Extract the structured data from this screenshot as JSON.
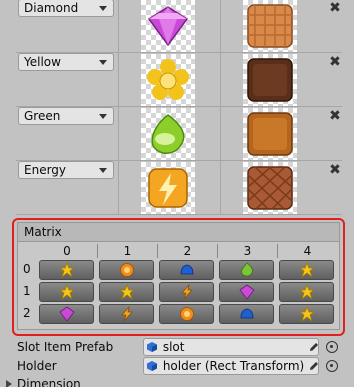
{
  "candy_rows": [
    {
      "label": "Diamond",
      "candy_icon": "diamond-candy-icon",
      "candy_color": "#c94ad6",
      "bg_icon": "waffle-tile-icon",
      "bg_color": "#d9894a"
    },
    {
      "label": "Yellow",
      "candy_icon": "yellow-flower-candy-icon",
      "candy_color": "#f2c31b",
      "bg_icon": "chocolate-tile-icon",
      "bg_color": "#5a2f1a"
    },
    {
      "label": "Green",
      "candy_icon": "green-drop-candy-icon",
      "candy_color": "#8ccf2a",
      "bg_icon": "caramel-tile-icon",
      "bg_color": "#b5651d"
    },
    {
      "label": "Energy",
      "candy_icon": "energy-bolt-candy-icon",
      "candy_color": "#f4a623",
      "bg_icon": "waffle-tile-icon",
      "bg_color": "#a85a34"
    }
  ],
  "matrix": {
    "title": "Matrix",
    "columns": [
      "0",
      "1",
      "2",
      "3",
      "4"
    ],
    "rows": [
      {
        "label": "0",
        "cells": [
          "yellow",
          "orange",
          "blue",
          "green",
          "yellow"
        ]
      },
      {
        "label": "1",
        "cells": [
          "yellow",
          "yellow",
          "energy",
          "diamond",
          "yellow"
        ]
      },
      {
        "label": "2",
        "cells": [
          "diamond",
          "energy",
          "orange",
          "blue",
          "yellow"
        ]
      }
    ]
  },
  "properties": [
    {
      "label": "Slot Item Prefab",
      "value": "slot",
      "icon": "cube-icon"
    },
    {
      "label": "Holder",
      "value": "holder (Rect Transform)",
      "icon": "cube-icon"
    }
  ],
  "foldout": {
    "label": "Dimension"
  },
  "colors": {
    "yellow": "#f5c518",
    "orange": "#f08c1a",
    "blue": "#1f5fd1",
    "green": "#7cc43a",
    "diamond": "#c94ad6",
    "energy": "#f4a623",
    "highlight": "#e02020"
  }
}
